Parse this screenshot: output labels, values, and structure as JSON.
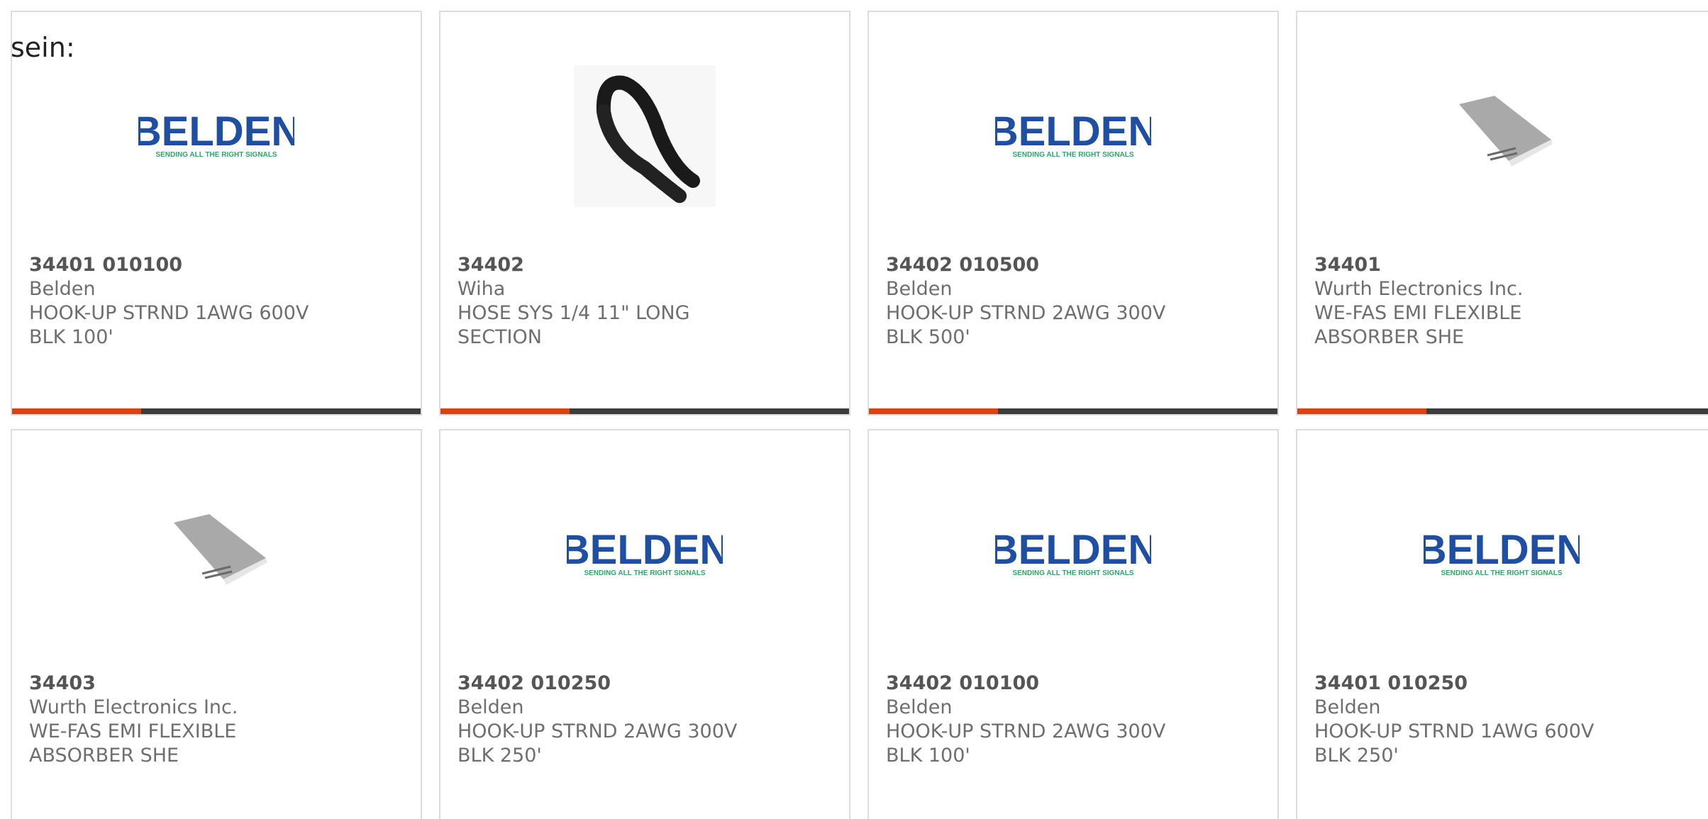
{
  "intro_text": "sein:",
  "colors": {
    "accent": "#e0400e",
    "bar_dark": "#3c3c3c",
    "border": "#dcdcdc",
    "text": "#6e6e6e",
    "belden_blue": "#1f4fa3",
    "belden_green": "#2aa66a"
  },
  "products": [
    {
      "part": "34401 010100",
      "maker": "Belden",
      "desc": "HOOK-UP STRND 1AWG 600V BLK 100'",
      "image": "belden-logo"
    },
    {
      "part": "34402",
      "maker": "Wiha",
      "desc": "HOSE SYS 1/4 11\" LONG SECTION",
      "image": "hose-photo"
    },
    {
      "part": "34402 010500",
      "maker": "Belden",
      "desc": "HOOK-UP STRND 2AWG 300V BLK 500'",
      "image": "belden-logo"
    },
    {
      "part": "34401",
      "maker": "Wurth Electronics Inc.",
      "desc": "WE-FAS EMI FLEXIBLE ABSORBER SHE",
      "image": "absorber-sheet-photo"
    },
    {
      "part": "34403",
      "maker": "Wurth Electronics Inc.",
      "desc": "WE-FAS EMI FLEXIBLE ABSORBER SHE",
      "image": "absorber-sheet-photo"
    },
    {
      "part": "34402 010250",
      "maker": "Belden",
      "desc": "HOOK-UP STRND 2AWG 300V BLK 250'",
      "image": "belden-logo"
    },
    {
      "part": "34402 010100",
      "maker": "Belden",
      "desc": "HOOK-UP STRND 2AWG 300V BLK 100'",
      "image": "belden-logo"
    },
    {
      "part": "34401 010250",
      "maker": "Belden",
      "desc": "HOOK-UP STRND 1AWG 600V BLK 250'",
      "image": "belden-logo"
    }
  ],
  "logo": {
    "wordmark": "BELDEN",
    "tagline": "SENDING ALL THE RIGHT SIGNALS"
  }
}
